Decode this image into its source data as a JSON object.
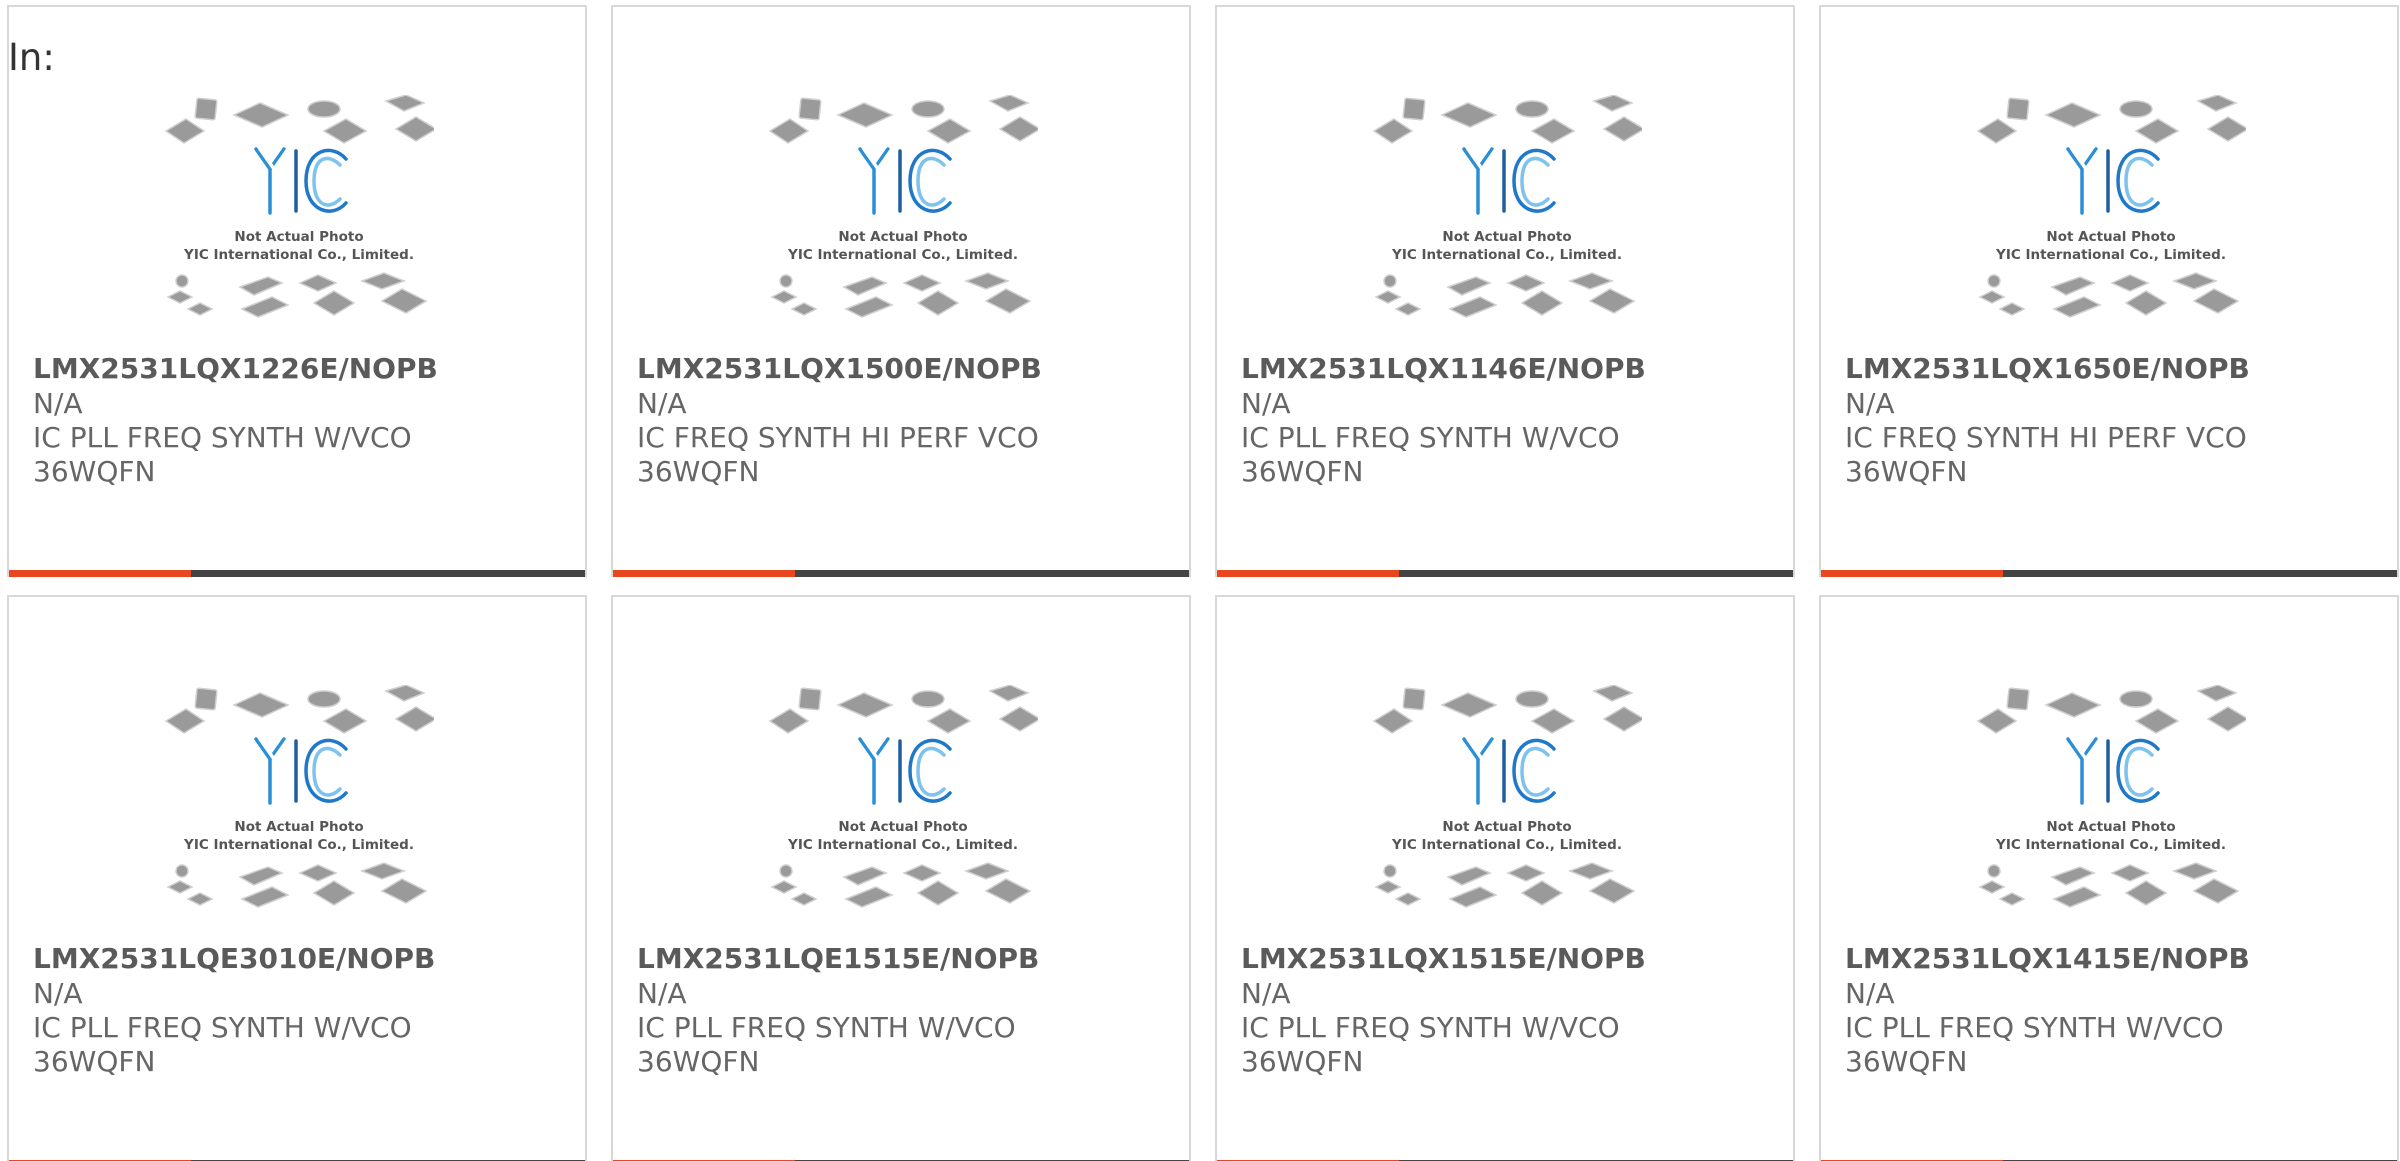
{
  "header": {
    "in_label": "In:"
  },
  "colors": {
    "accent": "#e8461e",
    "bar": "#444444",
    "logo_blue": "#1f78c8"
  },
  "placeholder": {
    "brand": "YIC",
    "caption_line1": "Not Actual Photo",
    "caption_line2": "YIC International Co., Limited."
  },
  "products": [
    {
      "part_number": "LMX2531LQX1226E/NOPB",
      "status": "N/A",
      "desc_line1": "IC PLL FREQ SYNTH W/VCO",
      "desc_line2": "36WQFN"
    },
    {
      "part_number": "LMX2531LQX1500E/NOPB",
      "status": "N/A",
      "desc_line1": "IC FREQ SYNTH HI PERF VCO",
      "desc_line2": "36WQFN"
    },
    {
      "part_number": "LMX2531LQX1146E/NOPB",
      "status": "N/A",
      "desc_line1": "IC PLL FREQ SYNTH W/VCO",
      "desc_line2": "36WQFN"
    },
    {
      "part_number": "LMX2531LQX1650E/NOPB",
      "status": "N/A",
      "desc_line1": "IC FREQ SYNTH HI PERF VCO",
      "desc_line2": "36WQFN"
    },
    {
      "part_number": "LMX2531LQE3010E/NOPB",
      "status": "N/A",
      "desc_line1": "IC PLL FREQ SYNTH W/VCO",
      "desc_line2": "36WQFN"
    },
    {
      "part_number": "LMX2531LQE1515E/NOPB",
      "status": "N/A",
      "desc_line1": "IC PLL FREQ SYNTH W/VCO",
      "desc_line2": "36WQFN"
    },
    {
      "part_number": "LMX2531LQX1515E/NOPB",
      "status": "N/A",
      "desc_line1": "IC PLL FREQ SYNTH W/VCO",
      "desc_line2": "36WQFN"
    },
    {
      "part_number": "LMX2531LQX1415E/NOPB",
      "status": "N/A",
      "desc_line1": "IC PLL FREQ SYNTH W/VCO",
      "desc_line2": "36WQFN"
    }
  ]
}
